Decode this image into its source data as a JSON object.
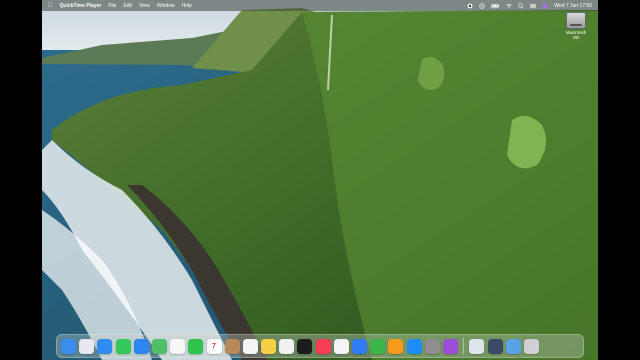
{
  "menubar": {
    "app_name": "QuickTime Player",
    "menus": [
      "File",
      "Edit",
      "View",
      "Window",
      "Help"
    ],
    "clock": "Wed 7 Jun  17:50"
  },
  "desktop": {
    "disk_label": "Macintosh HD"
  },
  "dock": {
    "apps": [
      {
        "icon": "finder-icon",
        "color": "#3d8cf0"
      },
      {
        "icon": "launchpad-icon",
        "color": "#e8e8ee"
      },
      {
        "icon": "safari-icon",
        "color": "#2f8cf0"
      },
      {
        "icon": "messages-icon",
        "color": "#34c759"
      },
      {
        "icon": "mail-icon",
        "color": "#2e86f5"
      },
      {
        "icon": "maps-icon",
        "color": "#4fbf6a"
      },
      {
        "icon": "photos-icon",
        "color": "#f7f7f7"
      },
      {
        "icon": "facetime-icon",
        "color": "#2fc24d"
      },
      {
        "icon": "calendar-icon",
        "color": "#ffffff",
        "text": "7"
      },
      {
        "icon": "contacts-icon",
        "color": "#b88a5a"
      },
      {
        "icon": "reminders-icon",
        "color": "#f4f4f4"
      },
      {
        "icon": "notes-icon",
        "color": "#f5cf45"
      },
      {
        "icon": "freeform-icon",
        "color": "#f1f1f1"
      },
      {
        "icon": "tv-icon",
        "color": "#1c1c1e"
      },
      {
        "icon": "music-icon",
        "color": "#fa3c55"
      },
      {
        "icon": "news-icon",
        "color": "#f4f4f4"
      },
      {
        "icon": "keynote-icon",
        "color": "#2f7cf6"
      },
      {
        "icon": "numbers-icon",
        "color": "#3cb44a"
      },
      {
        "icon": "pages-icon",
        "color": "#f79a1d"
      },
      {
        "icon": "app-store-icon",
        "color": "#1f8cf5"
      },
      {
        "icon": "system-settings-icon",
        "color": "#8e8e93"
      },
      {
        "icon": "podcasts-icon",
        "color": "#9b4fd8"
      }
    ],
    "extras": [
      {
        "icon": "preview-icon",
        "color": "#dfe4ea"
      },
      {
        "icon": "quicktime-icon",
        "color": "#3b4a66"
      },
      {
        "icon": "downloads-folder-icon",
        "color": "#5aa2e8"
      },
      {
        "icon": "trash-icon",
        "color": "#d0d0d4"
      }
    ]
  }
}
